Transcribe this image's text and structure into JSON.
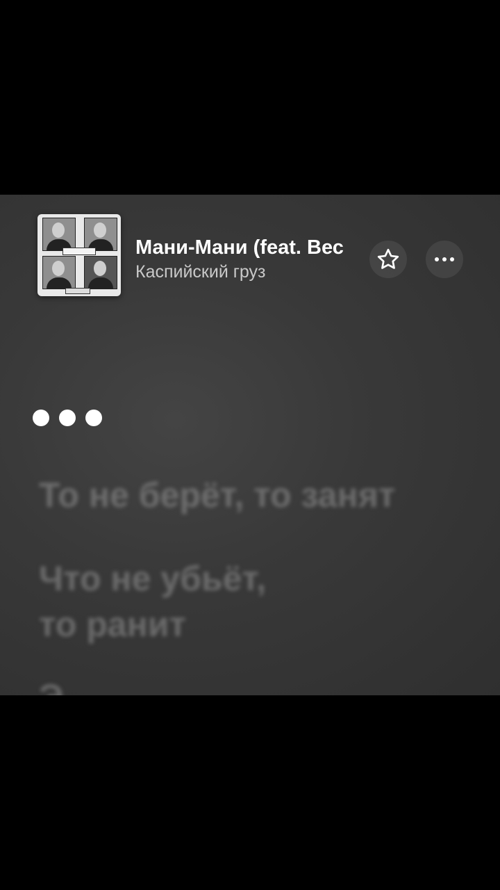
{
  "player": {
    "song_title": "Мани-Мани (feat. Вес",
    "artist": "Каспийский груз",
    "favorite_icon": "star-outline-icon",
    "more_icon": "ellipsis-icon"
  },
  "lyrics": {
    "waiting_indicator_icon": "three-dots-icon",
    "lines": [
      "То не берёт, то занят",
      "Что не убьёт,",
      "то ранит",
      "Э"
    ]
  }
}
